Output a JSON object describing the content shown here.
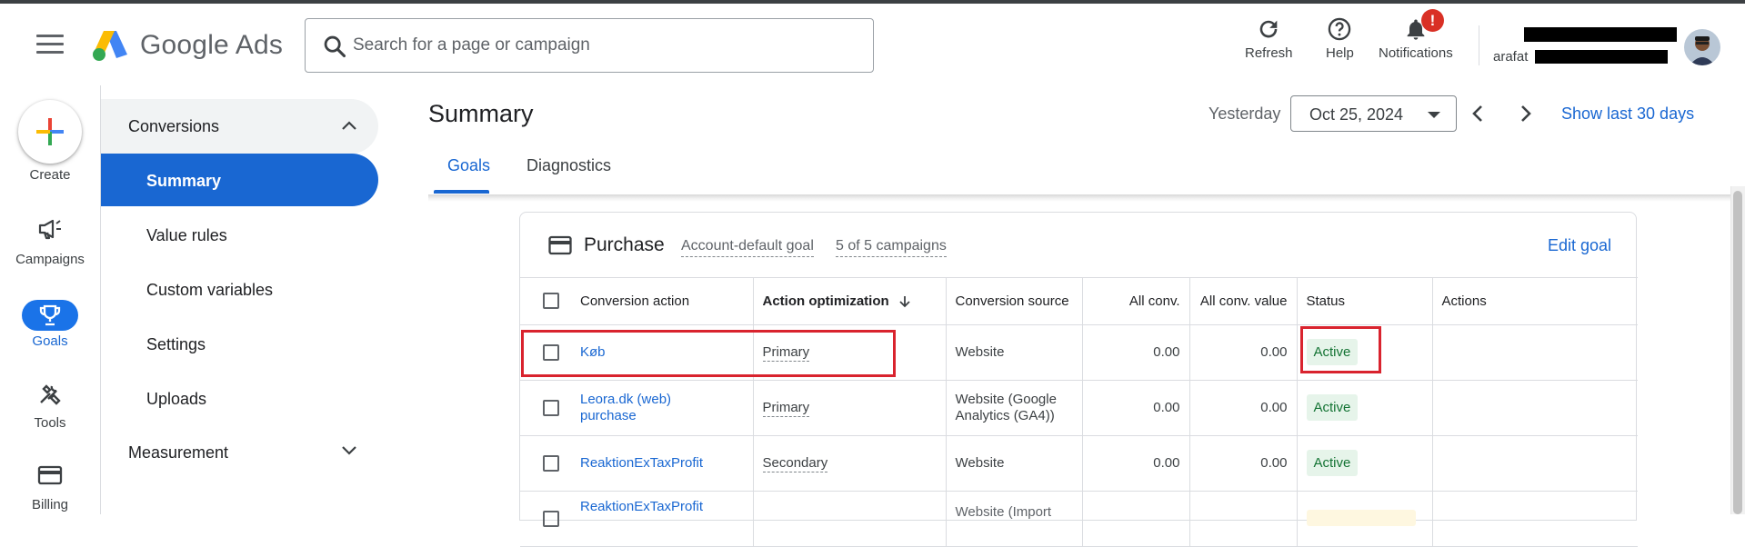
{
  "header": {
    "brand": "Google Ads",
    "search_placeholder": "Search for a page or campaign",
    "refresh_label": "Refresh",
    "help_label": "Help",
    "notifications_label": "Notifications",
    "notification_badge": "!",
    "account_name_visible": "arafat"
  },
  "leftnav": {
    "create_label": "Create",
    "campaigns_label": "Campaigns",
    "goals_label": "Goals",
    "tools_label": "Tools",
    "billing_label": "Billing"
  },
  "subnav": {
    "conversions_label": "Conversions",
    "items": [
      {
        "label": "Summary",
        "active": true
      },
      {
        "label": "Value rules",
        "active": false
      },
      {
        "label": "Custom variables",
        "active": false
      },
      {
        "label": "Settings",
        "active": false
      },
      {
        "label": "Uploads",
        "active": false
      }
    ],
    "measurement_label": "Measurement"
  },
  "page": {
    "title": "Summary",
    "date_label": "Yesterday",
    "date_value": "Oct 25, 2024",
    "show_last_30": "Show last 30 days"
  },
  "tabs": [
    {
      "label": "Goals",
      "active": true
    },
    {
      "label": "Diagnostics",
      "active": false
    }
  ],
  "card": {
    "title": "Purchase",
    "default_goal": "Account-default goal",
    "campaigns": "5 of 5 campaigns",
    "edit_goal": "Edit goal"
  },
  "table": {
    "headers": {
      "conversion_action": "Conversion action",
      "action_optimization": "Action optimization",
      "conversion_source": "Conversion source",
      "all_conv": "All conv.",
      "all_conv_value": "All conv. value",
      "status": "Status",
      "actions": "Actions"
    },
    "rows": [
      {
        "action": "Køb",
        "optimization": "Primary",
        "source": "Website",
        "all_conv": "0.00",
        "all_conv_value": "0.00",
        "status": "Active"
      },
      {
        "action": "Leora.dk (web) purchase",
        "optimization": "Primary",
        "source": "Website (Google Analytics (GA4))",
        "all_conv": "0.00",
        "all_conv_value": "0.00",
        "status": "Active"
      },
      {
        "action": "ReaktionExTaxProfit",
        "optimization": "Secondary",
        "source": "Website",
        "all_conv": "0.00",
        "all_conv_value": "0.00",
        "status": "Active"
      },
      {
        "action": "ReaktionExTaxProfit",
        "optimization": "",
        "source": "Website (Import",
        "all_conv": "",
        "all_conv_value": "",
        "status": ""
      }
    ]
  },
  "colors": {
    "accent_blue": "#1967d2",
    "active_green_bg": "#e6f4ea",
    "active_green_text": "#137333",
    "highlight_red": "#d9232e",
    "notification_red": "#d93025"
  },
  "icons": {
    "menu": "hamburger-icon",
    "search": "search-icon",
    "refresh": "refresh-icon",
    "help": "help-icon",
    "notifications": "bell-icon",
    "create": "plus-icon",
    "campaigns": "megaphone-icon",
    "goals": "trophy-icon",
    "tools": "tools-icon",
    "billing": "credit-card-icon",
    "card": "credit-card-icon",
    "sort": "arrow-down-icon"
  }
}
